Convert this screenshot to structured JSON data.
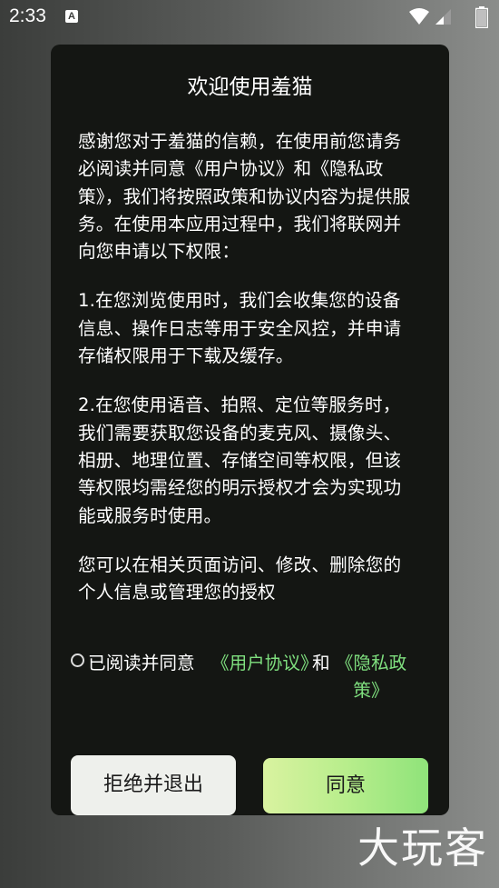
{
  "status_bar": {
    "time": "2:33",
    "app_icon_letter": "A"
  },
  "dialog": {
    "title": "欢迎使用羞猫",
    "paragraphs": [
      "感谢您对于羞猫的信赖，在使用前您请务必阅读并同意《用户协议》和《隐私政策》，我们将按照政策和协议内容为提供服务。在使用本应用过程中，我们将联网并向您申请以下权限：",
      "1.在您浏览使用时，我们会收集您的设备信息、操作日志等用于安全风控，并申请存储权限用于下载及缓存。",
      "2.在您使用语音、拍照、定位等服务时，我们需要获取您设备的麦克风、摄像头、相册、地理位置、存储空间等权限，但该等权限均需经您的明示授权才会为实现功能或服务时使用。",
      "您可以在相关页面访问、修改、删除您的个人信息或管理您的授权"
    ],
    "consent": {
      "prefix": "已阅读并同意",
      "terms_link": "《用户协议》",
      "and": "和",
      "privacy_link": "《隐私政策》"
    },
    "refuse_label": "拒绝并退出",
    "agree_label": "同意"
  },
  "watermark": "大玩客",
  "colors": {
    "dialog_bg": "#141613",
    "link": "#7fe07f",
    "agree_gradient_start": "#d9f2a0",
    "agree_gradient_end": "#8fe37a"
  }
}
